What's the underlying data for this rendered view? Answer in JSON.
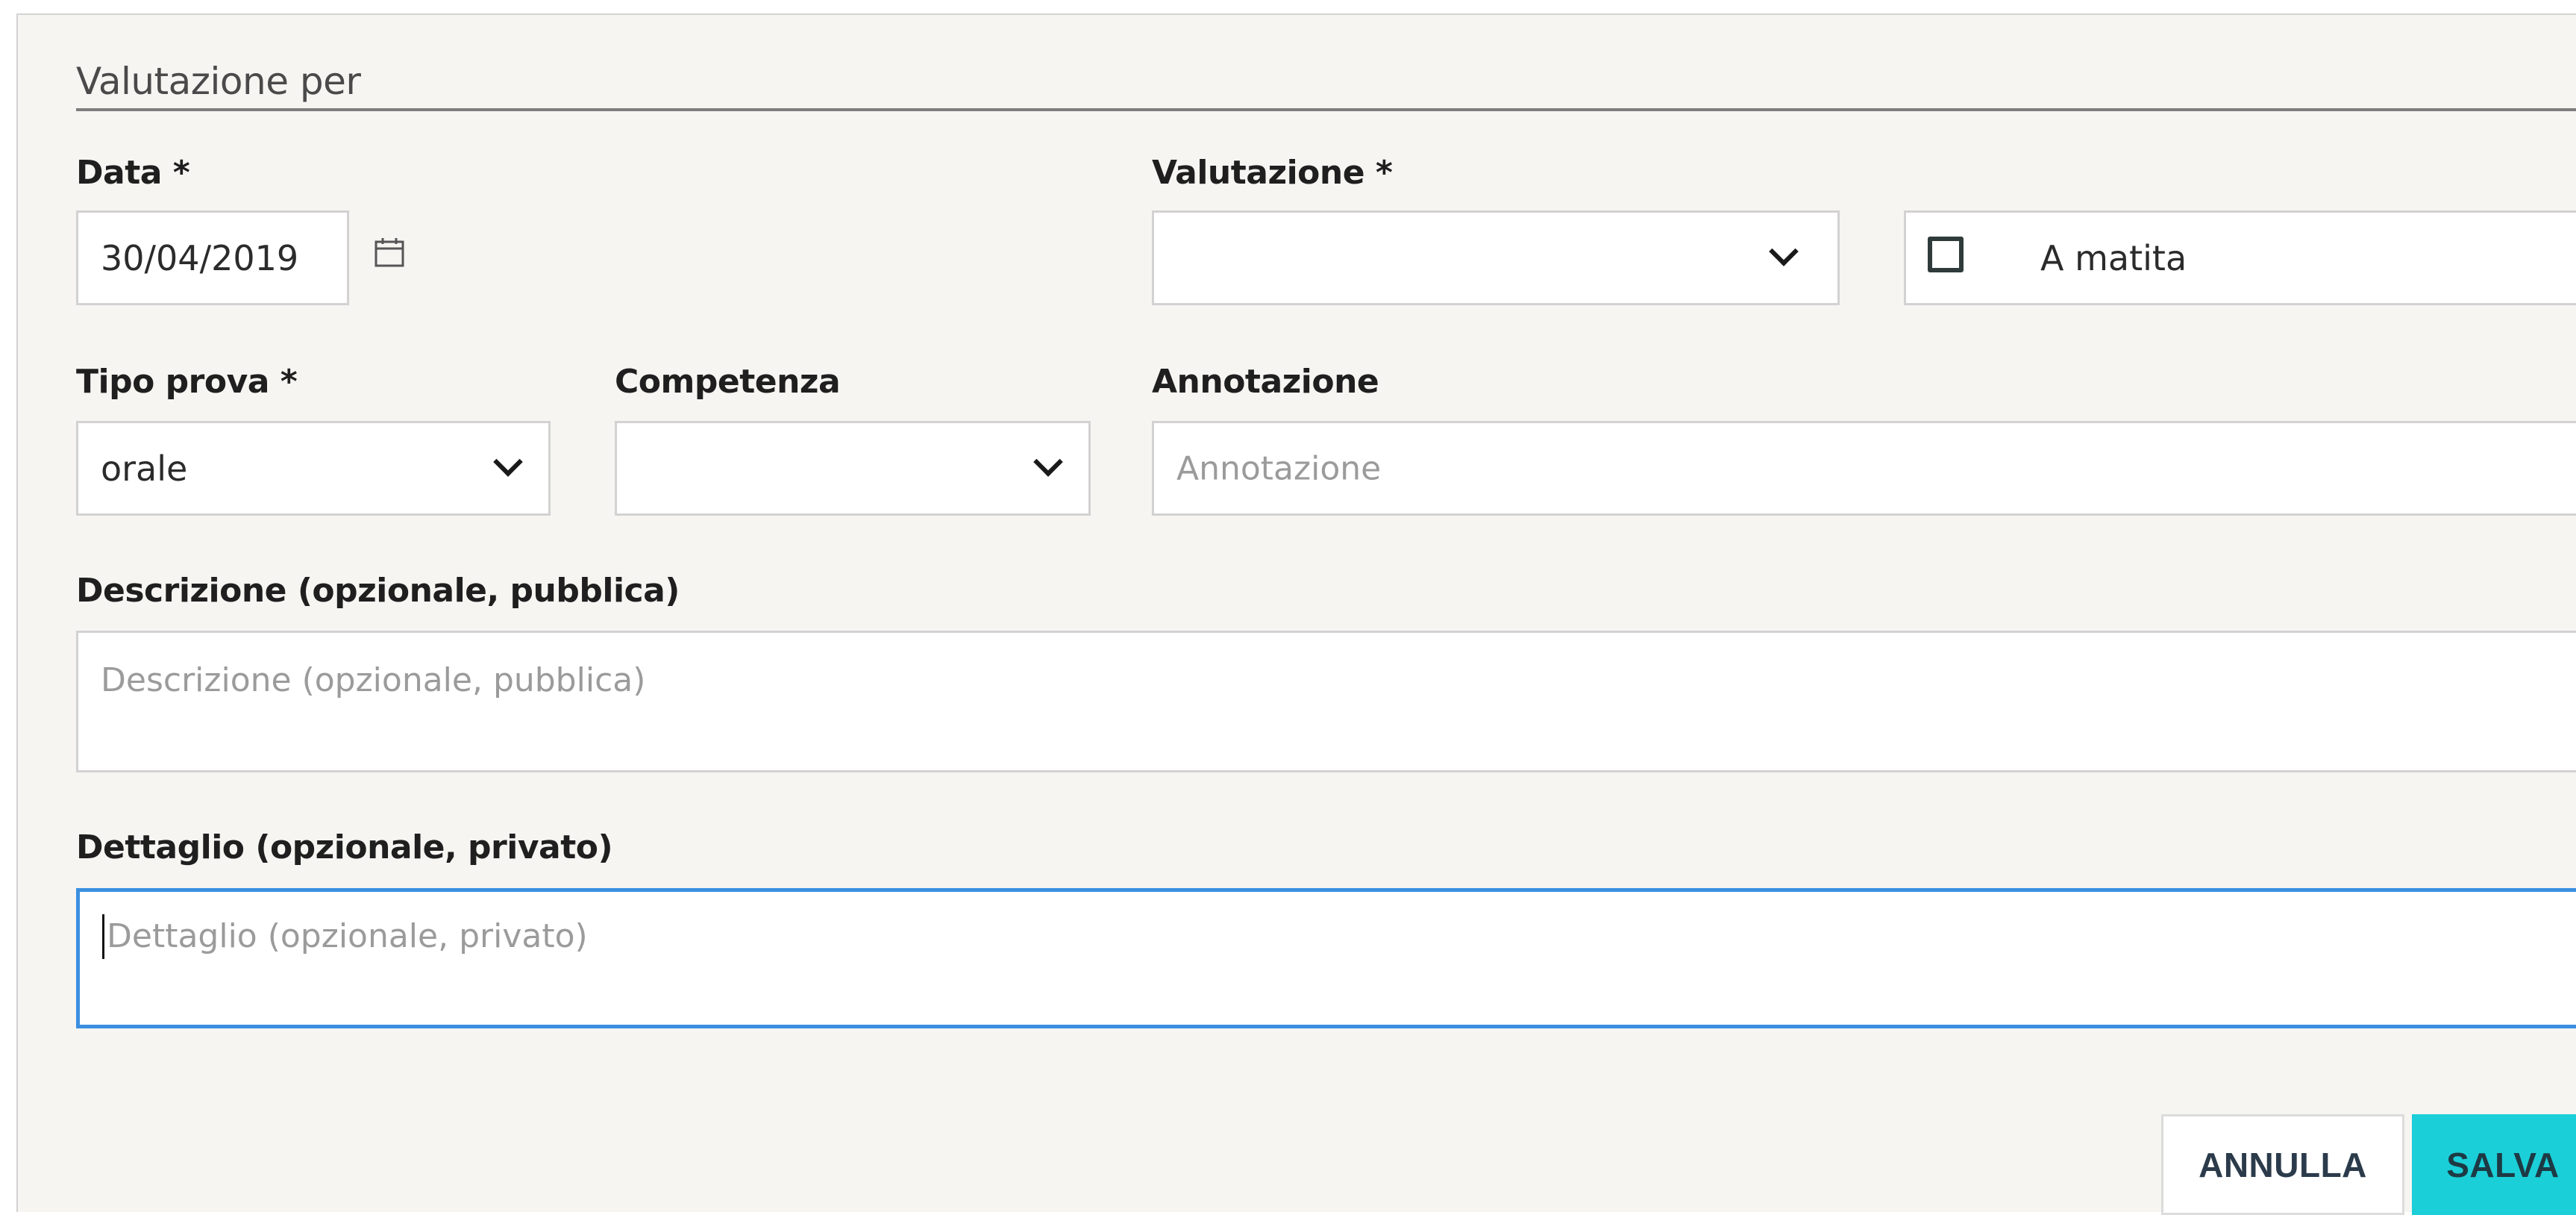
{
  "dialog": {
    "title": "Valutazione per"
  },
  "form": {
    "data": {
      "label": "Data *",
      "value": "30/04/2019"
    },
    "valutazione": {
      "label": "Valutazione *",
      "value": ""
    },
    "a_matita": {
      "label": "A matita",
      "checked": false
    },
    "tipo_prova": {
      "label": "Tipo prova *",
      "value": "orale"
    },
    "competenza": {
      "label": "Competenza",
      "value": ""
    },
    "annotazione": {
      "label": "Annotazione",
      "placeholder": "Annotazione",
      "value": ""
    },
    "descrizione": {
      "label": "Descrizione (opzionale, pubblica)",
      "placeholder": "Descrizione (opzionale, pubblica)",
      "value": ""
    },
    "dettaglio": {
      "label": "Dettaglio (opzionale, privato)",
      "placeholder": "Dettaglio (opzionale, privato)",
      "value": ""
    }
  },
  "actions": {
    "cancel_label": "ANNULLA",
    "save_label": "SALVA"
  },
  "icons": {
    "date_picker": "calendar-icon",
    "select_arrow": "chevron-down-icon",
    "checkbox": "checkbox-unchecked"
  },
  "colors": {
    "dialog_bg": "#f6f5f2",
    "focus_border": "#3b8fe0",
    "save_button_bg": "#1bcfd8",
    "input_border": "#d2d2d2"
  }
}
